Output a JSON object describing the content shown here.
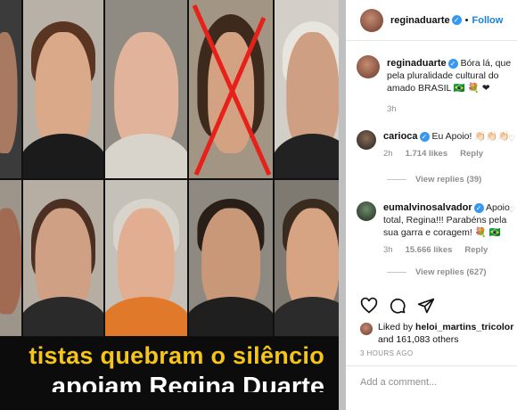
{
  "post": {
    "banner_line1": "tistas quebram o silêncio",
    "banner_line2": "apoiam Regina Duarte"
  },
  "header": {
    "username": "reginaduarte",
    "separator": "•",
    "follow_label": "Follow"
  },
  "caption": {
    "username": "reginaduarte",
    "text": "Bóra lá, que pela pluralidade cultural do amado BRASIL 🇧🇷 💐 ❤",
    "time": "3h"
  },
  "comments": [
    {
      "username": "carioca",
      "text": "Eu Apoio! 👏🏻👏🏻👏🏻",
      "time": "2h",
      "likes": "1.714 likes",
      "reply": "Reply",
      "view_replies": "View replies (39)"
    },
    {
      "username": "eumalvinosalvador",
      "text": "Apoio total, Regina!!! Parabéns pela sua garra e coragem! 💐 🇧🇷",
      "time": "3h",
      "likes": "15.666 likes",
      "reply": "Reply",
      "view_replies": "View replies (627)"
    }
  ],
  "liked_by": {
    "prefix": "Liked by",
    "user": "heloi_martins_tricolor",
    "suffix": "and 161,083 others"
  },
  "time_ago": "3 HOURS AGO",
  "add_comment": {
    "placeholder": "Add a comment..."
  },
  "icons": [
    "heart-icon",
    "comment-icon",
    "share-icon",
    "verified-badge-icon"
  ],
  "colors": {
    "banner_yellow": "#f5c518",
    "link_blue": "#1a7fd8",
    "cross_red": "#e8201a"
  }
}
